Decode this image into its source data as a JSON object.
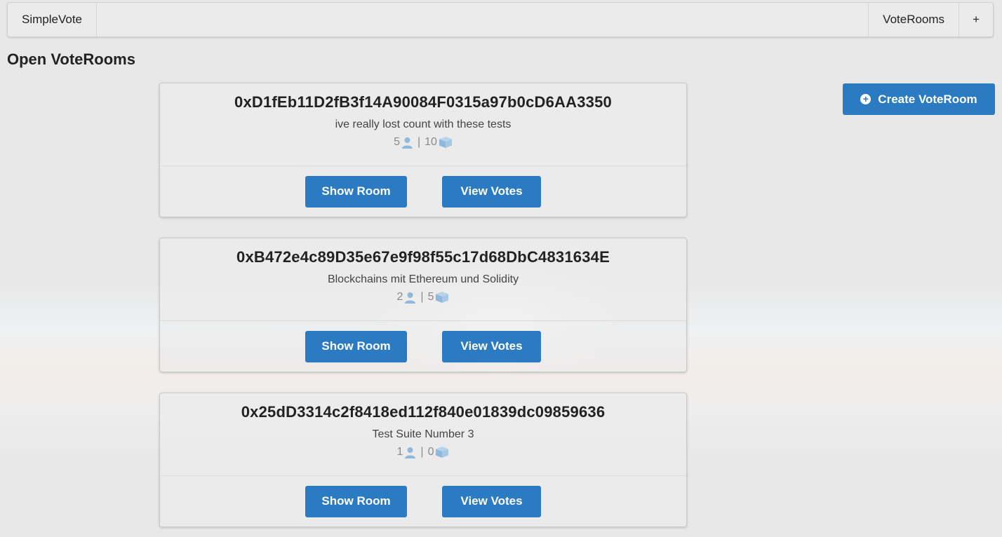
{
  "navbar": {
    "brand": "SimpleVote",
    "rooms_link": "VoteRooms",
    "add_link": "+"
  },
  "page": {
    "title": "Open VoteRooms",
    "create_button": "Create VoteRoom"
  },
  "rooms": [
    {
      "address": "0xD1fEb11D2fB3f14A90084F0315a97b0cD6AA3350",
      "description": "ive really lost count with these tests",
      "participants": "5",
      "votes": "10",
      "show_label": "Show Room",
      "votes_label": "View Votes"
    },
    {
      "address": "0xB472e4c89D35e67e9f98f55c17d68DbC4831634E",
      "description": "Blockchains mit Ethereum und Solidity",
      "participants": "2",
      "votes": "5",
      "show_label": "Show Room",
      "votes_label": "View Votes"
    },
    {
      "address": "0x25dD3314c2f8418ed112f840e01839dc09859636",
      "description": "Test Suite Number 3",
      "participants": "1",
      "votes": "0",
      "show_label": "Show Room",
      "votes_label": "View Votes"
    }
  ],
  "meta_separator": "|",
  "icons": {
    "participants": "user-icon",
    "votes": "ballot-box-icon",
    "create": "plus-circle-icon"
  },
  "colors": {
    "primary": "#2a7bc2",
    "icon_blue": "#8fb8dd"
  }
}
